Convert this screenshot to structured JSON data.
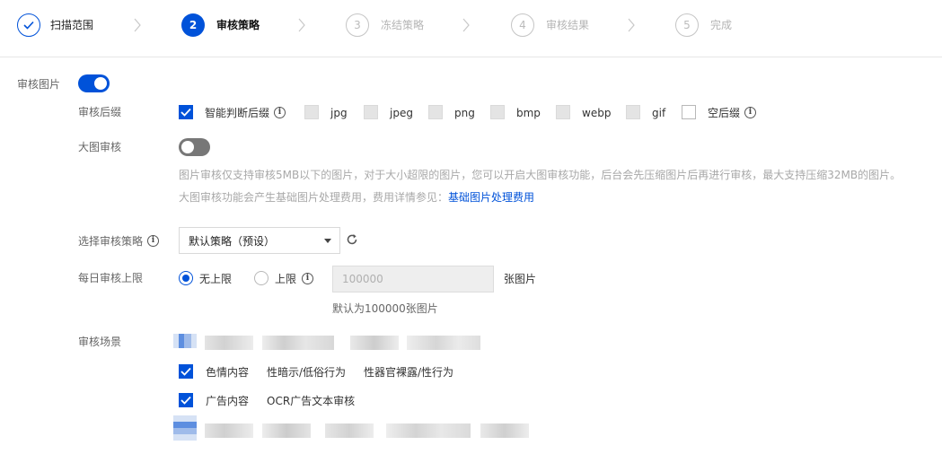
{
  "steps": [
    {
      "number": "",
      "label": "扫描范围",
      "state": "done"
    },
    {
      "number": "2",
      "label": "审核策略",
      "state": "active"
    },
    {
      "number": "3",
      "label": "冻结策略",
      "state": "todo"
    },
    {
      "number": "4",
      "label": "审核结果",
      "state": "todo"
    },
    {
      "number": "5",
      "label": "完成",
      "state": "todo"
    }
  ],
  "audit_image": {
    "label": "审核图片",
    "enabled": true
  },
  "suffix": {
    "label": "审核后缀",
    "options": [
      {
        "label": "智能判断后缀",
        "checked": true,
        "info": true
      },
      {
        "label": "jpg",
        "checked": false
      },
      {
        "label": "jpeg",
        "checked": false
      },
      {
        "label": "png",
        "checked": false
      },
      {
        "label": "bmp",
        "checked": false
      },
      {
        "label": "webp",
        "checked": false
      },
      {
        "label": "gif",
        "checked": false
      },
      {
        "label": "空后缀",
        "checked": false,
        "info": true
      }
    ]
  },
  "large_image": {
    "label": "大图审核",
    "enabled": false,
    "hint1": "图片审核仅支持审核5MB以下的图片，对于大小超限的图片，您可以开启大图审核功能，后台会先压缩图片后再进行审核，最大支持压缩32MB的图片。",
    "hint2_prefix": "大图审核功能会产生基础图片处理费用，费用详情参见：",
    "hint2_link": "基础图片处理费用"
  },
  "strategy": {
    "label": "选择审核策略",
    "selected": "默认策略（预设）"
  },
  "daily_limit": {
    "label": "每日审核上限",
    "option_unlimited": "无上限",
    "option_limit": "上限",
    "unlimited_selected": true,
    "input_placeholder": "100000",
    "unit": "张图片",
    "hint": "默认为100000张图片"
  },
  "scene": {
    "label": "审核场景",
    "rows": [
      {
        "category": "色情内容",
        "checked": true,
        "items": [
          "性暗示/低俗行为",
          "性器官裸露/性行为"
        ]
      },
      {
        "category": "广告内容",
        "checked": true,
        "items": [
          "OCR广告文本审核"
        ]
      }
    ]
  },
  "colors": {
    "primary": "#0052d9",
    "muted": "#a8a8a8"
  },
  "icons": {
    "done_step": "check-icon",
    "step_separator": "chevron-right-icon",
    "info": "info-icon",
    "refresh": "refresh-icon"
  }
}
